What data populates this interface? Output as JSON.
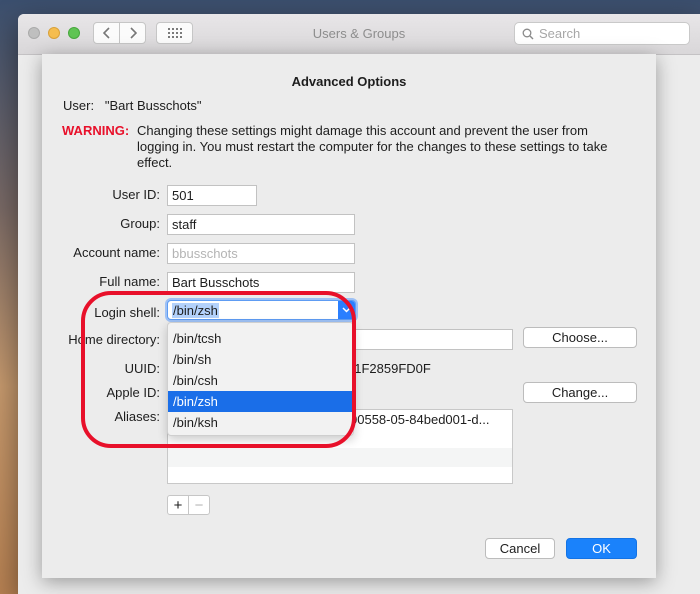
{
  "window": {
    "title": "Users & Groups",
    "search_placeholder": "Search"
  },
  "sheet": {
    "title": "Advanced Options",
    "user_line": "User:   \"Bart Busschots\"",
    "warning_label": "WARNING:",
    "warning_text": "Changing these settings might damage this account and prevent the user from logging in. You must restart the computer for the changes to these settings to take effect."
  },
  "fields": {
    "user_id": {
      "label": "User ID:",
      "value": "501"
    },
    "group": {
      "label": "Group:",
      "value": "staff"
    },
    "account_name": {
      "label": "Account name:",
      "placeholder": "bbusschots"
    },
    "full_name": {
      "label": "Full name:",
      "value": "Bart Busschots"
    },
    "login_shell": {
      "label": "Login shell:",
      "value": "/bin/zsh"
    },
    "home_directory": {
      "label": "Home directory:"
    },
    "uuid": {
      "label": "UUID:",
      "value_fragment": "21F2859FD0F"
    },
    "apple_id": {
      "label": "Apple ID:"
    },
    "aliases": {
      "label": "Aliases:",
      "items": [
        "00558-05-84bed001-d..."
      ]
    }
  },
  "dropdown": {
    "options": [
      "/bin/tcsh",
      "/bin/sh",
      "/bin/csh",
      "/bin/zsh",
      "/bin/ksh"
    ],
    "selected_index": 3
  },
  "buttons": {
    "choose": "Choose...",
    "change": "Change...",
    "add": "+",
    "remove": "−",
    "cancel": "Cancel",
    "ok": "OK"
  },
  "colors": {
    "accent": "#1a82fb",
    "warning": "#e8102a",
    "highlight_ring": "#e8102a"
  }
}
